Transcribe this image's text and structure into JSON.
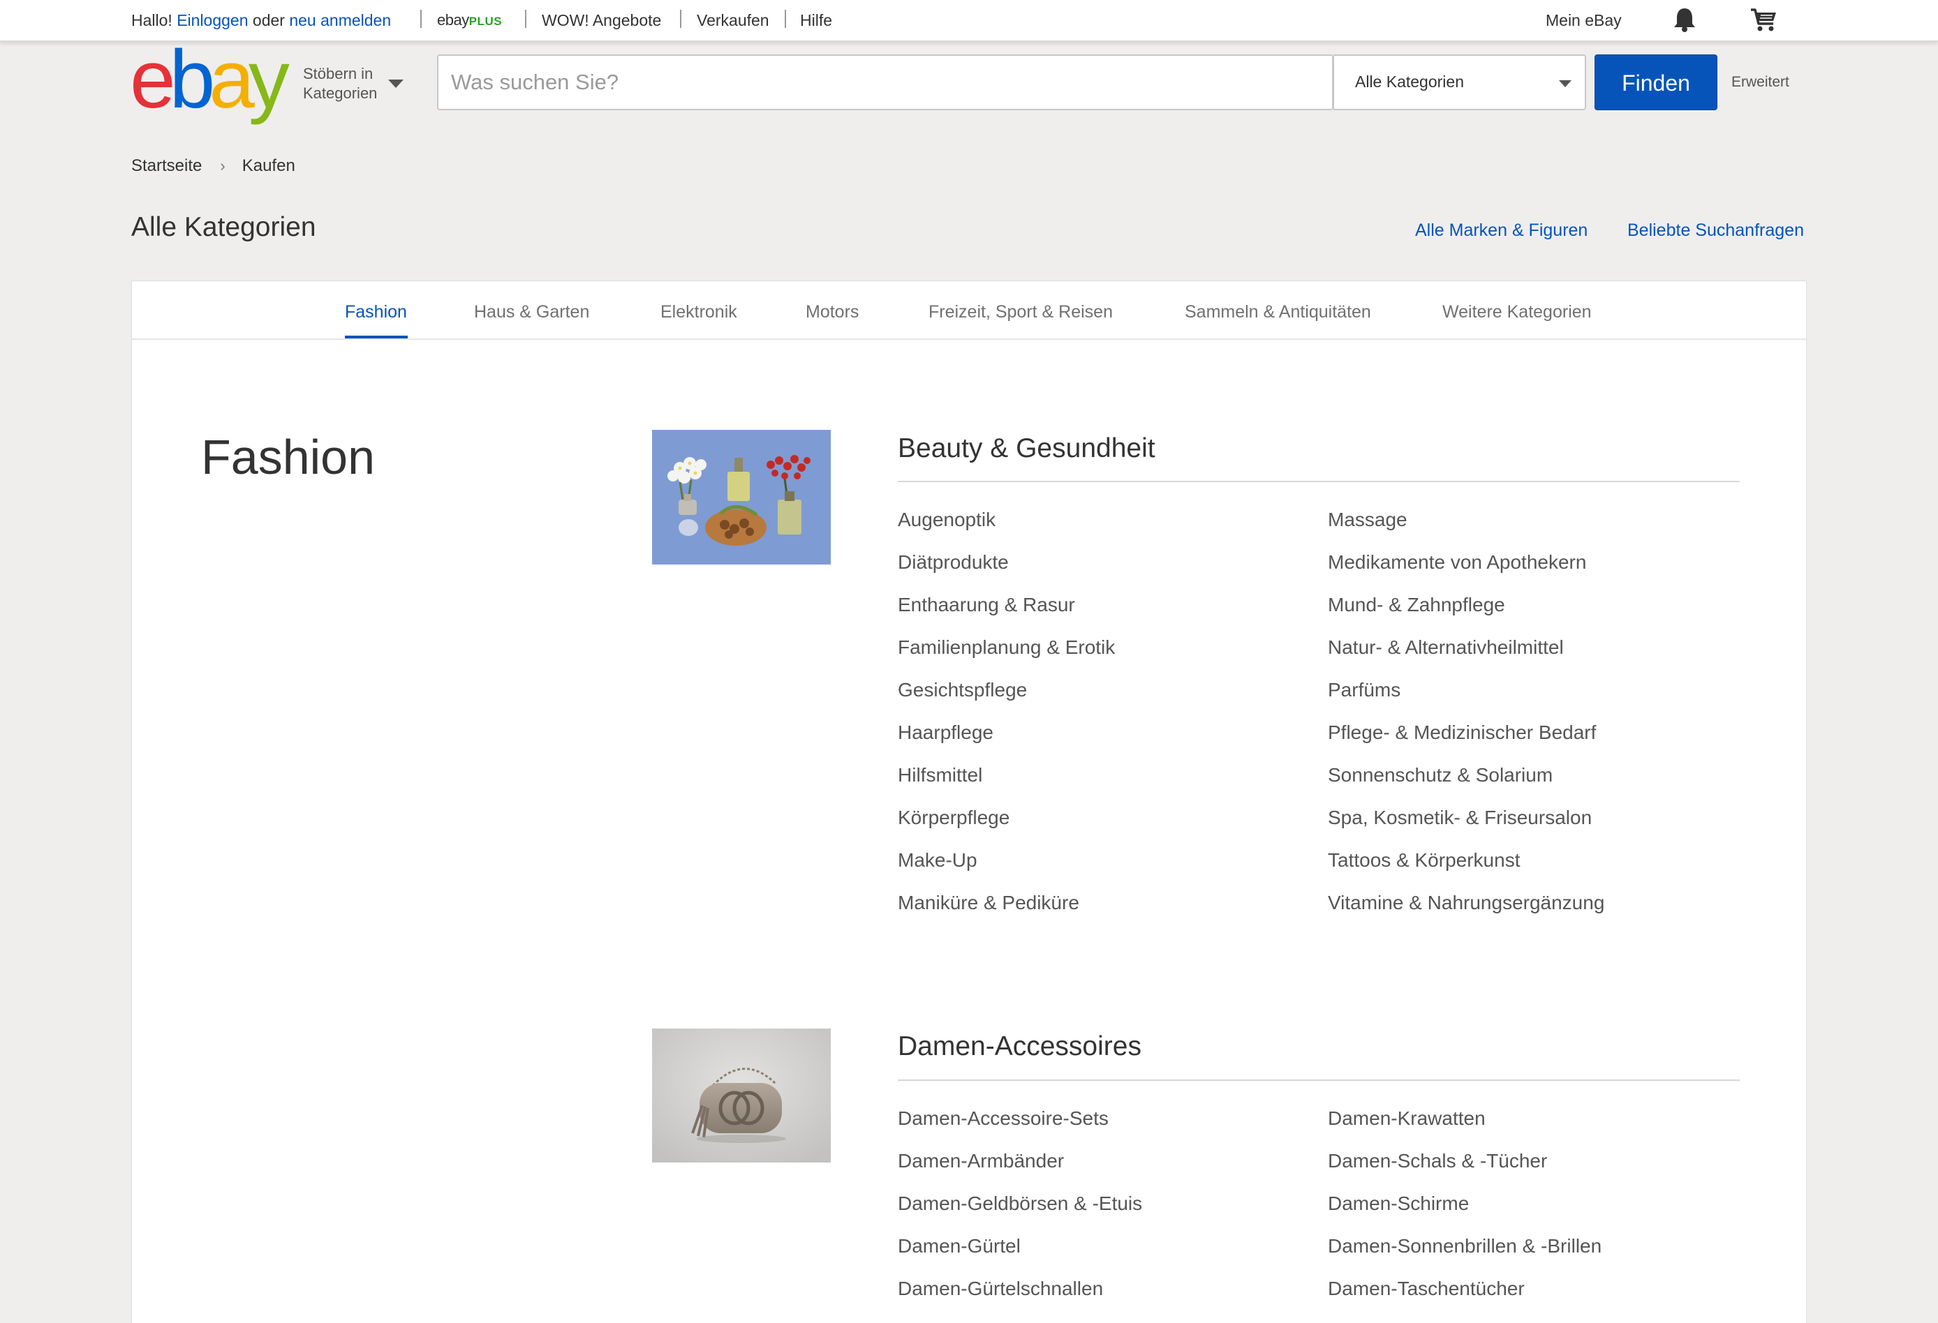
{
  "topbar": {
    "greeting": "Hallo!",
    "login": "Einloggen",
    "or": "oder",
    "register": "neu anmelden",
    "ebayplus_brand": "ebay",
    "ebayplus_plus": "PLUS",
    "deals": "WOW! Angebote",
    "sell": "Verkaufen",
    "help": "Hilfe",
    "my_ebay": "Mein eBay",
    "icons": [
      "bell-icon",
      "cart-icon"
    ]
  },
  "header": {
    "logo": [
      "e",
      "b",
      "a",
      "y"
    ],
    "browse_line1": "Stöbern in",
    "browse_line2": "Kategorien",
    "search_placeholder": "Was suchen Sie?",
    "search_value": "",
    "category_select": "Alle Kategorien",
    "find_button": "Finden",
    "advanced": "Erweitert"
  },
  "breadcrumb": [
    "Startseite",
    "Kaufen"
  ],
  "breadcrumb_separator": "›",
  "page": {
    "title": "Alle Kategorien",
    "links": [
      "Alle Marken & Figuren",
      "Beliebte Suchanfragen"
    ]
  },
  "tabs": [
    "Fashion",
    "Haus & Garten",
    "Elektronik",
    "Motors",
    "Freizeit, Sport & Reisen",
    "Sammeln & Antiquitäten",
    "Weitere Kategorien"
  ],
  "active_tab": "Fashion",
  "section": {
    "title": "Fashion",
    "groups": [
      {
        "heading": "Beauty & Gesundheit",
        "col1": [
          "Augenoptik",
          "Diätprodukte",
          "Enthaarung & Rasur",
          "Familienplanung & Erotik",
          "Gesichtspflege",
          "Haarpflege",
          "Hilfsmittel",
          "Körperpflege",
          "Make-Up",
          "Maniküre & Pediküre"
        ],
        "col2": [
          "Massage",
          "Medikamente von Apothekern",
          "Mund- & Zahnpflege",
          "Natur- & Alternativheilmittel",
          "Parfüms",
          "Pflege- & Medizinischer Bedarf",
          "Sonnenschutz & Solarium",
          "Spa, Kosmetik- & Friseursalon",
          "Tattoos & Körperkunst",
          "Vitamine & Nahrungsergänzung"
        ]
      },
      {
        "heading": "Damen-Accessoires",
        "col1": [
          "Damen-Accessoire-Sets",
          "Damen-Armbänder",
          "Damen-Geldbörsen & -Etuis",
          "Damen-Gürtel",
          "Damen-Gürtelschnallen"
        ],
        "col2": [
          "Damen-Krawatten",
          "Damen-Schals & -Tücher",
          "Damen-Schirme",
          "Damen-Sonnenbrillen & -Brillen",
          "Damen-Taschentücher"
        ]
      }
    ]
  },
  "colors": {
    "link_blue": "#0654ba",
    "background": "#efeeed",
    "ebay_red": "#e53238",
    "ebay_blue": "#0064d2",
    "ebay_yellow": "#f5af02",
    "ebay_green": "#86b817"
  }
}
